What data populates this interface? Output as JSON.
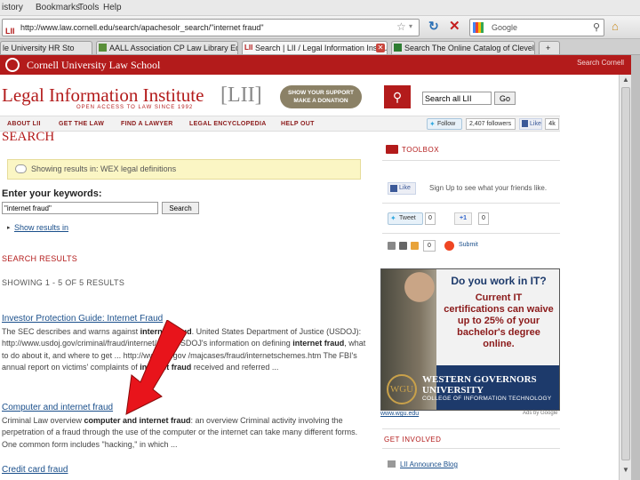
{
  "browser": {
    "menu": [
      "istory",
      "Bookmarks",
      "Tools",
      "Help"
    ],
    "url": "http://www.law.cornell.edu/search/apachesolr_search/\"internet fraud\"",
    "search_engine_label": "Google",
    "tabs": [
      {
        "label": "le University HR Sto"
      },
      {
        "label": "AALL Association CP Law Library Educ..."
      },
      {
        "label": "Search | LII / Legal Information Institute"
      },
      {
        "label": "Search The Online Catalog of Cleveland..."
      }
    ],
    "new_tab": "+"
  },
  "cornell": {
    "name": "Cornell University Law School",
    "search_link": "Search Cornell"
  },
  "header": {
    "title": "Legal Information Institute",
    "tagline": "OPEN ACCESS TO LAW SINCE 1992",
    "logo": "[LII]",
    "donate_line1": "SHOW YOUR SUPPORT",
    "donate_line2": "MAKE A DONATION",
    "search_placeholder": "Search all LII",
    "go_label": "Go"
  },
  "nav": {
    "items": [
      "ABOUT LII",
      "GET THE LAW",
      "FIND A LAWYER",
      "LEGAL ENCYCLOPEDIA",
      "HELP OUT"
    ],
    "follow_label": "Follow",
    "followers_label": "2,407 followers",
    "fb_like_label": "Like",
    "fb_count": "4k"
  },
  "main": {
    "heading": "SEARCH",
    "banner": "Showing results in: WEX legal definitions",
    "keywords_label": "Enter your keywords:",
    "keywords_value": "\"internet fraud\"",
    "search_button": "Search",
    "show_results_in": "Show results in",
    "results_heading": "SEARCH RESULTS",
    "showing": "SHOWING 1 - 5 OF 5 RESULTS",
    "results": [
      {
        "title": "Investor Protection Guide: Internet Fraud",
        "snippet_html": "The SEC describes and warns against <b>internet fraud</b>. United States Department of Justice (USDOJ): http://www.usdoj.gov/criminal/fraud/internet/ The USDOJ's information on defining <b>internet fraud</b>, what to do about it, and where to get ... http://www.fbi.gov /majcases/fraud/internetschemes.htm The FBI's annual report on victims' complaints of <b>internet fraud</b> received and referred ..."
      },
      {
        "title": "Computer and internet fraud",
        "snippet_html": "Criminal Law overview <b>computer and internet fraud</b>: an overview Criminal activity involving the perpetration of a fraud through the use of the computer or the internet can take many different forms. One common form includes \"hacking,\" in which ..."
      },
      {
        "title": "Credit card fraud",
        "snippet_html": ""
      }
    ]
  },
  "sidebar": {
    "toolbox_label": "TOOLBOX",
    "fb_like": "Like",
    "signup_text": "Sign Up to see what your friends like.",
    "tweet_label": "Tweet",
    "tweet_count": "0",
    "gplus_label": "+1",
    "gplus_count": "0",
    "share_count": "0",
    "submit_label": "Submit",
    "ad": {
      "question": "Do you work in IT?",
      "body": "Current IT certifications can waive up to 25% of your bachelor's degree online.",
      "seal": "WGU",
      "school_line1": "WESTERN GOVERNORS",
      "school_line2": "UNIVERSITY",
      "college": "COLLEGE OF INFORMATION TECHNOLOGY",
      "domain": "www.wgu.edu",
      "ads_by": "Ads by Google"
    },
    "get_involved": "GET INVOLVED",
    "blog_link": "LII Announce Blog"
  },
  "colors": {
    "cornell_red": "#b31b1b",
    "link_blue": "#1a4f8b",
    "banner_yellow": "#fbf6c4",
    "arrow_red": "#e8141b"
  }
}
